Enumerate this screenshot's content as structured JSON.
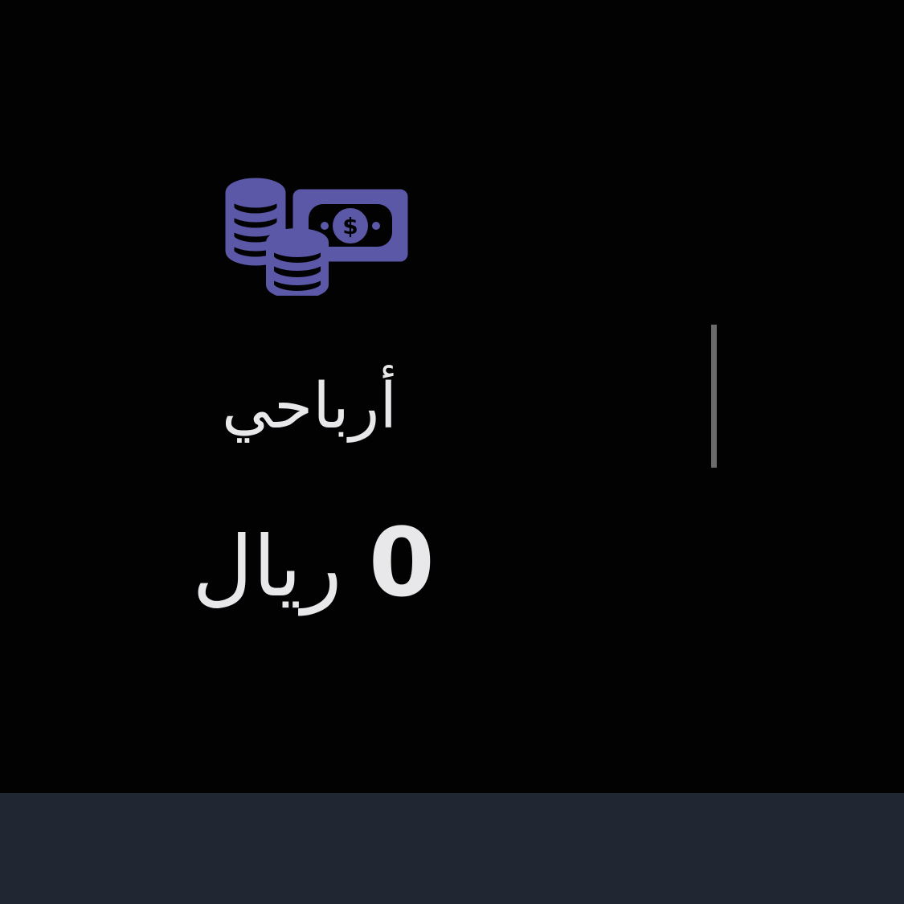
{
  "earnings": {
    "icon": "money-icon",
    "label": "أرباحي",
    "amount": "0",
    "currency": "ريال"
  },
  "colors": {
    "background": "#030203",
    "icon": "#5b58a8",
    "text": "#e8e8ea",
    "divider": "#6b6b6e",
    "bottom_bar": "#212633"
  }
}
